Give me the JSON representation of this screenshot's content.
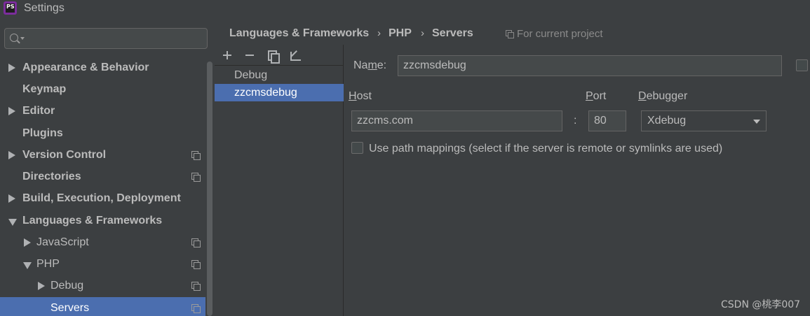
{
  "window": {
    "title": "Settings",
    "app_icon": "PS"
  },
  "search": {
    "placeholder": ""
  },
  "sidebar": {
    "items": [
      {
        "label": "Appearance & Behavior",
        "expandable": true,
        "expanded": false,
        "project_icon": false
      },
      {
        "label": "Keymap",
        "expandable": false,
        "project_icon": false
      },
      {
        "label": "Editor",
        "expandable": true,
        "expanded": false,
        "project_icon": false
      },
      {
        "label": "Plugins",
        "expandable": false,
        "project_icon": false
      },
      {
        "label": "Version Control",
        "expandable": true,
        "expanded": false,
        "project_icon": true
      },
      {
        "label": "Directories",
        "expandable": false,
        "project_icon": true
      },
      {
        "label": "Build, Execution, Deployment",
        "expandable": true,
        "expanded": false,
        "project_icon": false
      },
      {
        "label": "Languages & Frameworks",
        "expandable": true,
        "expanded": true,
        "project_icon": false
      },
      {
        "label": "JavaScript",
        "expandable": true,
        "expanded": false,
        "project_icon": true
      },
      {
        "label": "PHP",
        "expandable": true,
        "expanded": true,
        "project_icon": true
      },
      {
        "label": "Debug",
        "expandable": true,
        "expanded": false,
        "project_icon": true
      },
      {
        "label": "Servers",
        "expandable": false,
        "selected": true,
        "project_icon": true
      }
    ]
  },
  "breadcrumb": {
    "items": [
      "Languages & Frameworks",
      "PHP",
      "Servers"
    ],
    "separator": "›",
    "scope_label": "For current project"
  },
  "servers": {
    "list": [
      {
        "label": "Debug",
        "selected": false
      },
      {
        "label": "zzcmsdebug",
        "selected": true
      }
    ]
  },
  "form": {
    "name_label_pre": "Na",
    "name_label_u": "m",
    "name_label_post": "e:",
    "name_value": "zzcmsdebug",
    "host_label_u": "H",
    "host_label_post": "ost",
    "host_value": "zzcms.com",
    "colon": ":",
    "port_label_u": "P",
    "port_label_post": "ort",
    "port_value": "80",
    "debugger_label_u": "D",
    "debugger_label_post": "ebugger",
    "debugger_value": "Xdebug",
    "path_mappings_label": "Use path mappings (select if the server is remote or symlinks are used)",
    "path_mappings_checked": false,
    "shared_checked": false
  },
  "watermark": "CSDN @桃李007",
  "colors": {
    "accent_selection": "#4b6eaf",
    "background": "#3c3f41",
    "text": "#bbbbbb"
  }
}
